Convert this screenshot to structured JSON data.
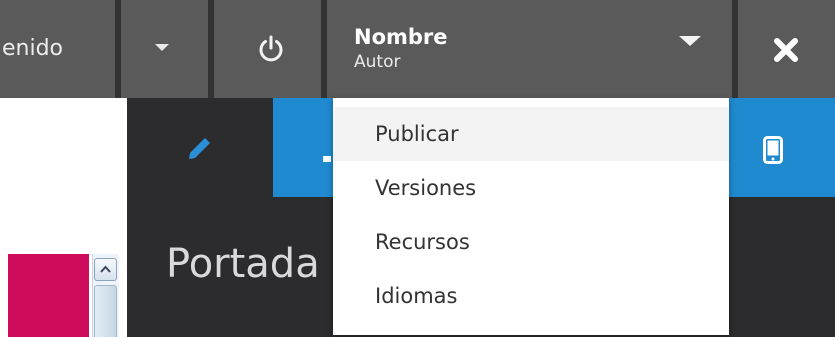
{
  "topbar": {
    "content_label": "enido",
    "user": {
      "name": "Nombre",
      "role": "Autor"
    },
    "icons": {
      "caret": "caret-down-icon",
      "power": "power-icon",
      "close": "close-icon"
    }
  },
  "editor": {
    "title": "Portada",
    "icons": {
      "edit": "pencil-icon",
      "mobile": "mobile-icon"
    },
    "tab_color": "#1f8ad0"
  },
  "dropdown": {
    "items": [
      {
        "label": "Publicar",
        "active": true
      },
      {
        "label": "Versiones",
        "active": false
      },
      {
        "label": "Recursos",
        "active": false
      },
      {
        "label": "Idiomas",
        "active": false
      }
    ]
  },
  "background_page": {
    "accent_color": "#cf0c5b"
  }
}
